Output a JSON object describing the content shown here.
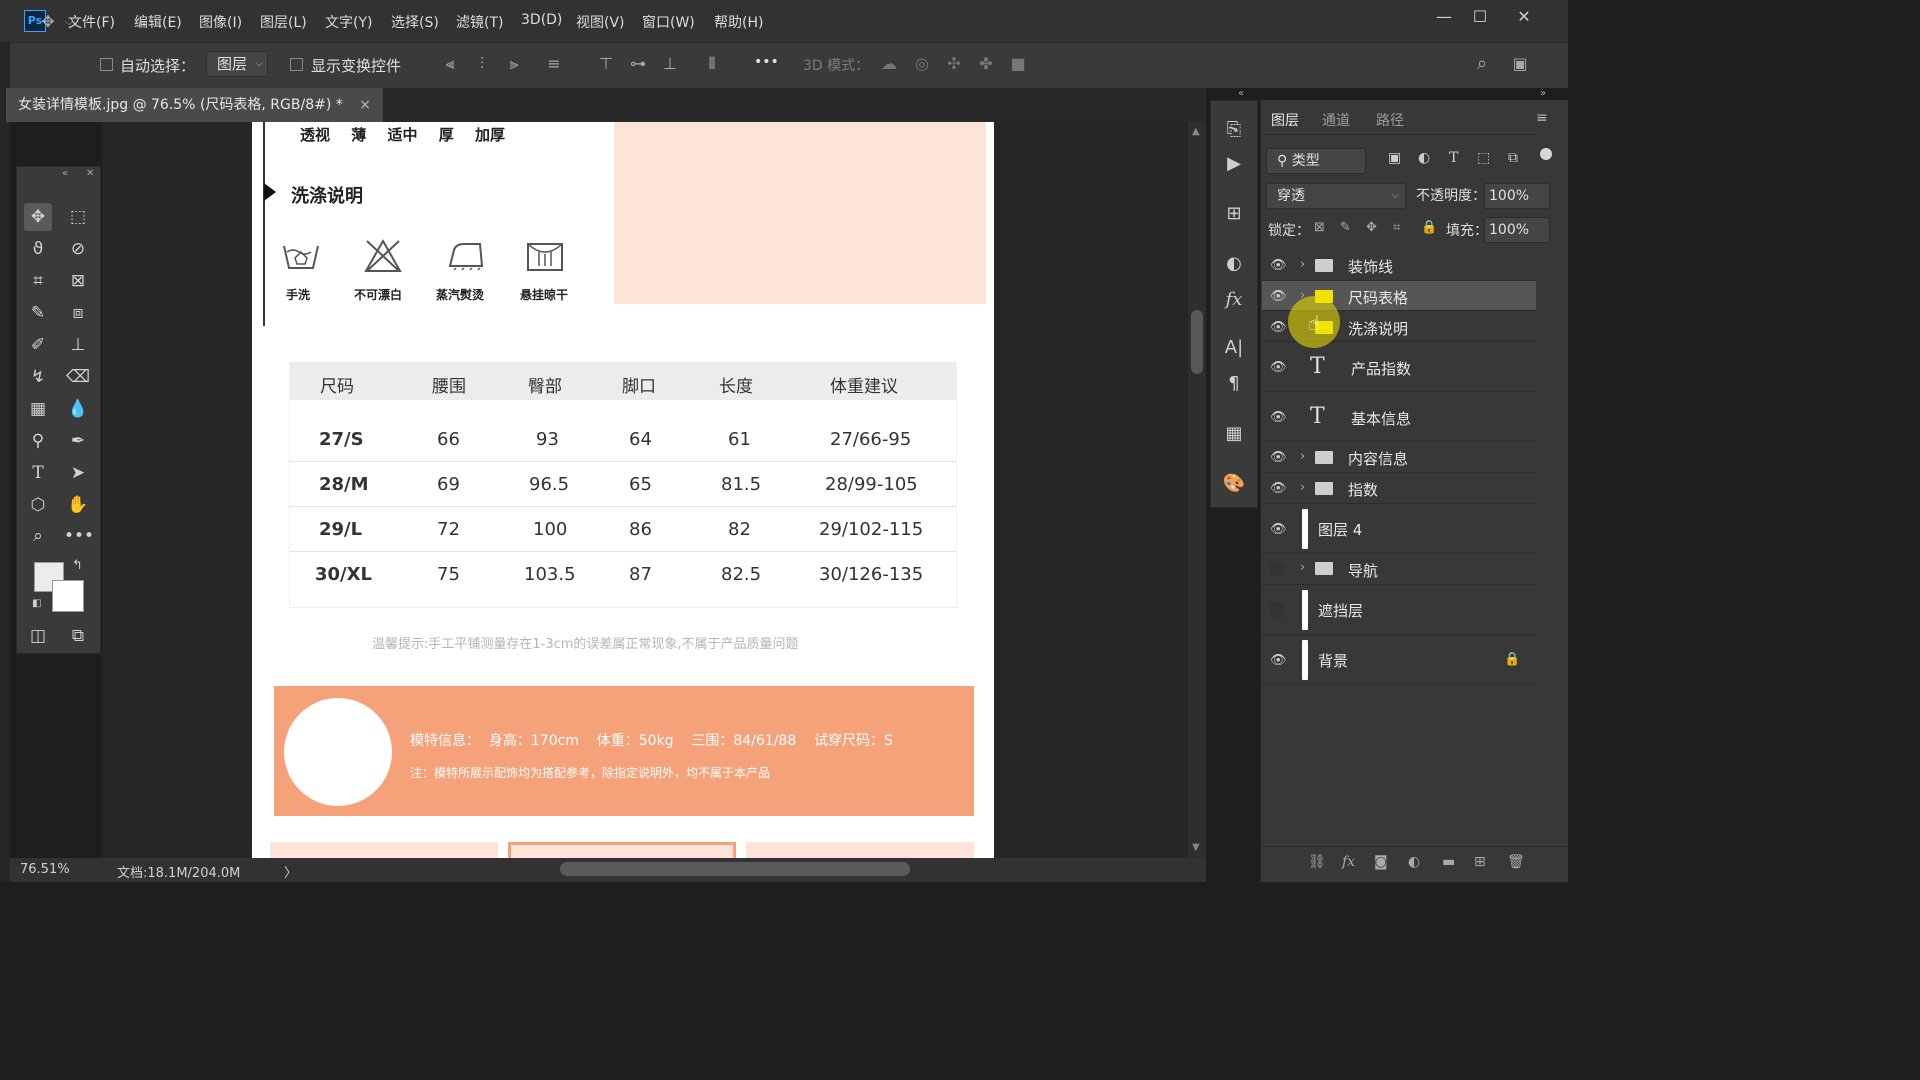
{
  "app": {
    "logo": "Ps"
  },
  "menu": [
    "文件(F)",
    "编辑(E)",
    "图像(I)",
    "图层(L)",
    "文字(Y)",
    "选择(S)",
    "滤镜(T)",
    "3D(D)",
    "视图(V)",
    "窗口(W)",
    "帮助(H)"
  ],
  "options": {
    "auto_select_label": "自动选择：",
    "auto_select_value": "图层",
    "show_transform_label": "显示变换控件",
    "more": "•••",
    "mode_3d_label": "3D 模式："
  },
  "document": {
    "tab_title": "女装详情模板.jpg @ 76.5% (尺码表格, RGB/8#) *",
    "close": "×"
  },
  "status": {
    "zoom": "76.51%",
    "doc_size": "文档:18.1M/204.0M",
    "arrow": "〉"
  },
  "canvas": {
    "fabric_options": [
      "透视",
      "薄",
      "适中",
      "厚",
      "加厚"
    ],
    "wash_title": "洗涤说明",
    "wash_icons": [
      {
        "label": "手洗",
        "icon": "hand-wash-icon"
      },
      {
        "label": "不可漂白",
        "icon": "no-bleach-icon"
      },
      {
        "label": "蒸汽熨烫",
        "icon": "steam-iron-icon"
      },
      {
        "label": "悬挂晾干",
        "icon": "hang-dry-icon"
      }
    ],
    "size_table": {
      "headers": [
        "尺码",
        "腰围",
        "臀部",
        "脚口",
        "长度",
        "体重建议"
      ],
      "rows": [
        [
          "27/S",
          "66",
          "93",
          "64",
          "61",
          "27/66-95"
        ],
        [
          "28/M",
          "69",
          "96.5",
          "65",
          "81.5",
          "28/99-105"
        ],
        [
          "29/L",
          "72",
          "100",
          "86",
          "82",
          "29/102-115"
        ],
        [
          "30/XL",
          "75",
          "103.5",
          "87",
          "82.5",
          "30/126-135"
        ]
      ]
    },
    "tip": "温馨提示:手工平铺测量存在1-3cm的误差属正常现象,不属于产品质量问题",
    "model_info": "模特信息：  身高：170cm    体重：50kg    三围：84/61/88    试穿尺码：S",
    "model_note": "注：模特所展示配饰均为搭配参考，除指定说明外，均不属于本产品",
    "colors": {
      "peach": "#fde3d8",
      "orange_band": "#f5a27a",
      "accent_yellow": "#f0e300"
    }
  },
  "layers_panel": {
    "tabs": [
      "图层",
      "通道",
      "路径"
    ],
    "filter_label": "类型",
    "blend_mode": "穿透",
    "opacity_label": "不透明度：",
    "opacity_value": "100%",
    "lock_label": "锁定：",
    "fill_label": "填充：",
    "fill_value": "100%",
    "layers": [
      {
        "name": "装饰线",
        "kind": "group",
        "visible": true
      },
      {
        "name": "尺码表格",
        "kind": "group",
        "visible": true,
        "selected": true,
        "color": "yellow"
      },
      {
        "name": "洗涤说明",
        "kind": "group",
        "visible": true,
        "color": "yellow"
      },
      {
        "name": "产品指数",
        "kind": "text",
        "visible": true
      },
      {
        "name": "基本信息",
        "kind": "text",
        "visible": true
      },
      {
        "name": "内容信息",
        "kind": "group",
        "visible": true
      },
      {
        "name": "指数",
        "kind": "group",
        "visible": true
      },
      {
        "name": "图层 4",
        "kind": "pixel",
        "visible": true
      },
      {
        "name": "导航",
        "kind": "group",
        "visible": false
      },
      {
        "name": "遮挡层",
        "kind": "pixel",
        "visible": false
      },
      {
        "name": "背景",
        "kind": "pixel",
        "visible": true,
        "locked": true
      }
    ]
  }
}
